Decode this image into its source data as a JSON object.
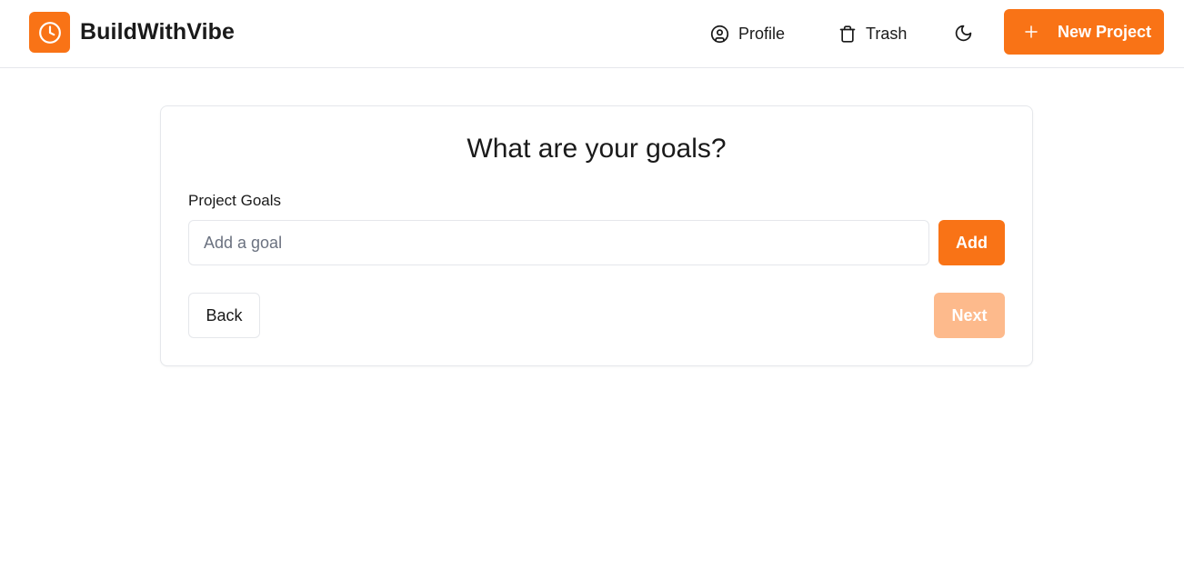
{
  "app": {
    "brand": "BuildWithVibe",
    "logo_icon": "clock-icon",
    "accent_color": "#f97316",
    "accent_disabled_color": "#fdba8c"
  },
  "nav": {
    "profile_label": "Profile",
    "profile_icon": "user-circle-icon",
    "trash_label": "Trash",
    "trash_icon": "trash-icon",
    "theme_icon": "moon-icon",
    "new_project_label": "New Project",
    "new_project_icon": "plus-icon"
  },
  "card": {
    "title": "What are your goals?",
    "field_label": "Project Goals",
    "goal_input": {
      "value": "",
      "placeholder": "Add a goal"
    },
    "add_label": "Add",
    "back_label": "Back",
    "next_label": "Next",
    "next_disabled": true
  }
}
